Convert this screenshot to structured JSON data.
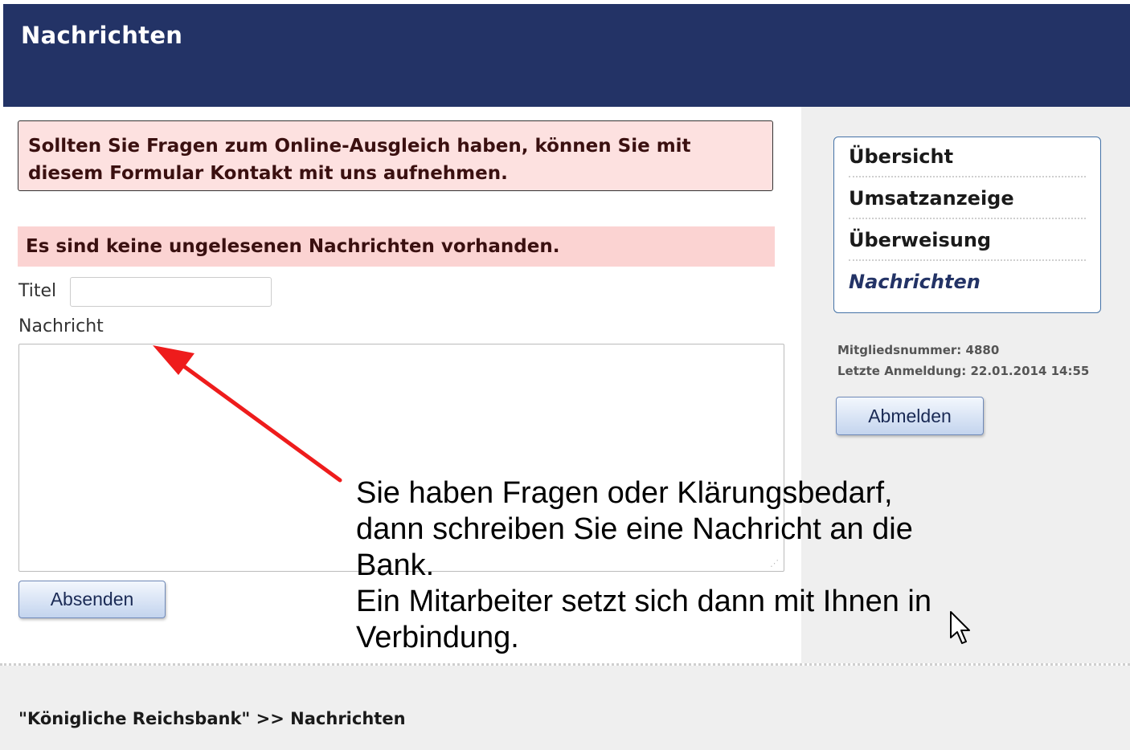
{
  "header": {
    "title": "Nachrichten"
  },
  "main": {
    "info_text": "Sollten Sie Fragen zum Online-Ausgleich haben, können Sie mit diesem Formular Kontakt mit uns aufnehmen.",
    "notice_text": "Es sind keine ungelesenen Nachrichten vorhanden.",
    "form": {
      "title_label": "Titel",
      "title_value": "",
      "message_label": "Nachricht",
      "message_value": "",
      "submit_label": "Absenden"
    }
  },
  "sidebar": {
    "nav": [
      {
        "label": "Übersicht",
        "active": false
      },
      {
        "label": "Umsatzanzeige",
        "active": false
      },
      {
        "label": "Überweisung",
        "active": false
      },
      {
        "label": "Nachrichten",
        "active": true
      }
    ],
    "member_number": "Mitgliedsnummer: 4880",
    "last_login": "Letzte Anmeldung: 22.01.2014 14:55",
    "logout_label": "Abmelden"
  },
  "footer": {
    "breadcrumb": "\"Königliche Reichsbank\" >> Nachrichten"
  },
  "annotation": {
    "lines": [
      "Sie haben Fragen oder Klärungsbedarf,",
      "dann schreiben Sie eine Nachricht an die",
      "Bank.",
      "Ein Mitarbeiter setzt sich dann mit Ihnen in",
      "Verbindung."
    ],
    "arrow_color": "#ee1c1c"
  },
  "colors": {
    "header_bg": "#233366",
    "notice_bg": "#fbd3d2",
    "info_bg": "#fde1e0",
    "sidebar_bg": "#efefef",
    "nav_active": "#233366"
  }
}
